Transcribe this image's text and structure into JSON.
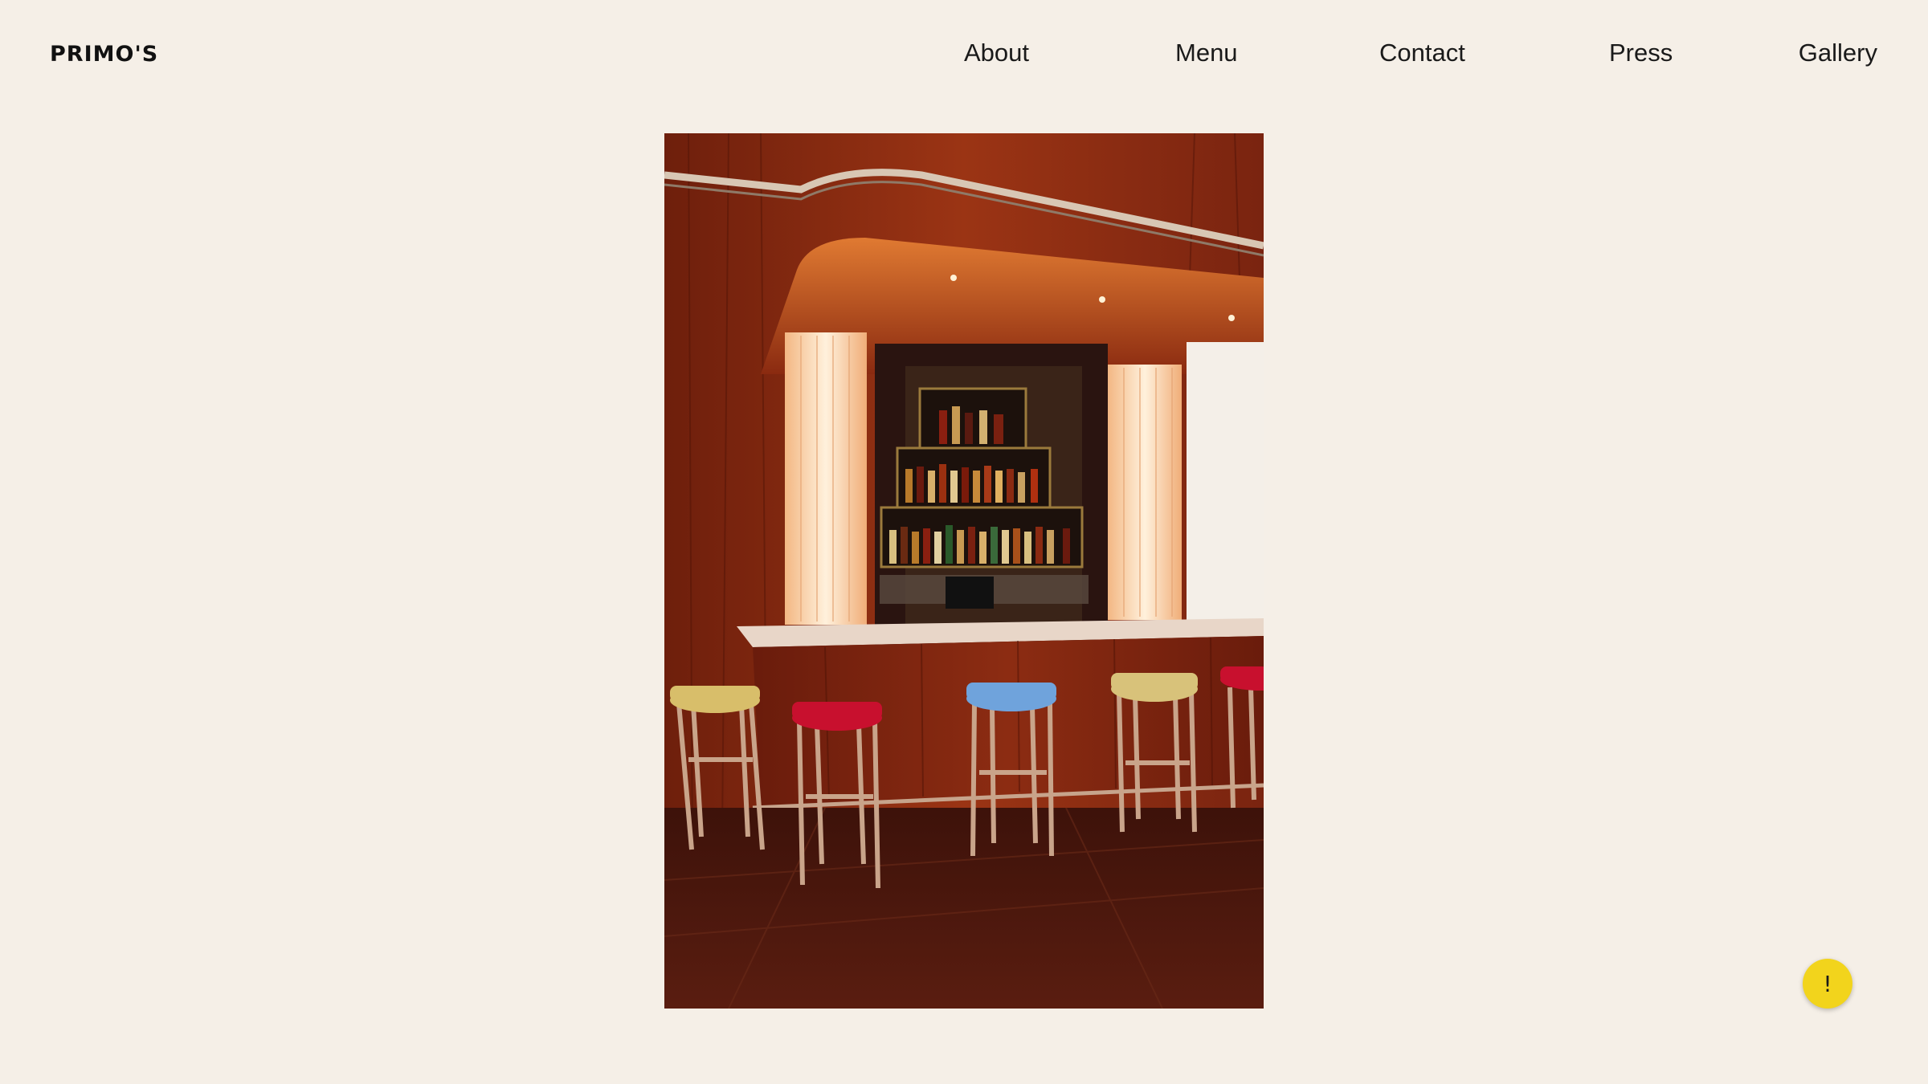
{
  "brand": {
    "logo_text": "PRIMO'S"
  },
  "nav": {
    "items": [
      {
        "label": "About"
      },
      {
        "label": "Menu"
      },
      {
        "label": "Contact"
      },
      {
        "label": "Press"
      },
      {
        "label": "Gallery"
      }
    ]
  },
  "hero": {
    "image_subject": "bar interior with wood paneling, back-bar shelves of bottles and colorful stools",
    "stool_colors": [
      "#d8be6a",
      "#c8102e",
      "#6fa3dc",
      "#d8c27a",
      "#c8102e"
    ]
  },
  "floating_button": {
    "label": "!",
    "color": "#f2d41c"
  }
}
